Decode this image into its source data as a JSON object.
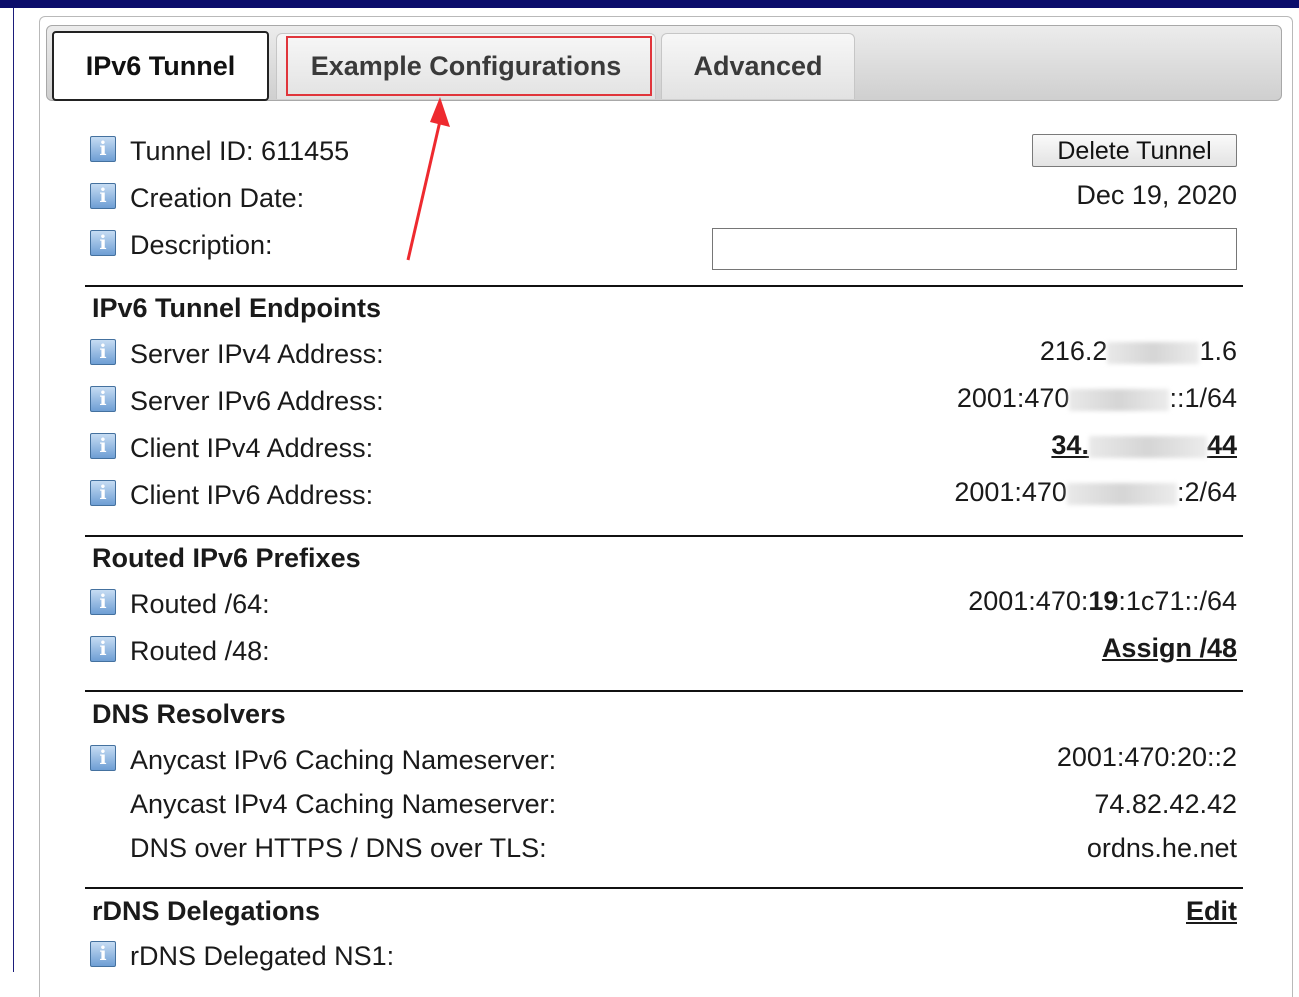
{
  "tabs": [
    {
      "label": "IPv6 Tunnel",
      "active": true
    },
    {
      "label": "Example Configurations",
      "active": false,
      "highlighted": true
    },
    {
      "label": "Advanced",
      "active": false
    }
  ],
  "info_icon_glyph": "i",
  "tunnel": {
    "id_label": "Tunnel ID: 611455",
    "delete_button": "Delete Tunnel",
    "creation_label": "Creation Date:",
    "creation_value": "Dec 19, 2020",
    "description_label": "Description:",
    "description_value": ""
  },
  "endpoints": {
    "title": "IPv6 Tunnel Endpoints",
    "server_ipv4_label": "Server IPv4 Address:",
    "server_ipv4_pre": "216.2",
    "server_ipv4_post": "1.6",
    "server_ipv6_label": "Server IPv6 Address:",
    "server_ipv6_pre": "2001:470",
    "server_ipv6_post": "::1/64",
    "client_ipv4_label": "Client IPv4 Address:",
    "client_ipv4_pre": "34.",
    "client_ipv4_post": "44",
    "client_ipv6_label": "Client IPv6 Address:",
    "client_ipv6_pre": "2001:470",
    "client_ipv6_post": ":2/64"
  },
  "routed": {
    "title": "Routed IPv6 Prefixes",
    "r64_label": "Routed /64:",
    "r64_pre": "2001:470:",
    "r64_bold": "19",
    "r64_post": ":1c71::/64",
    "r48_label": "Routed /48:",
    "r48_link": "Assign /48"
  },
  "dns": {
    "title": "DNS Resolvers",
    "ipv6_label": "Anycast IPv6 Caching Nameserver:",
    "ipv6_value": "2001:470:20::2",
    "ipv4_label": "Anycast IPv4 Caching Nameserver:",
    "ipv4_value": "74.82.42.42",
    "doh_label": "DNS over HTTPS / DNS over TLS:",
    "doh_value": "ordns.he.net"
  },
  "rdns": {
    "title": "rDNS Delegations",
    "edit_link": "Edit",
    "ns1_label": "rDNS Delegated NS1:"
  },
  "colors": {
    "topbar": "#0b0d6b",
    "highlight": "#e0353b"
  }
}
